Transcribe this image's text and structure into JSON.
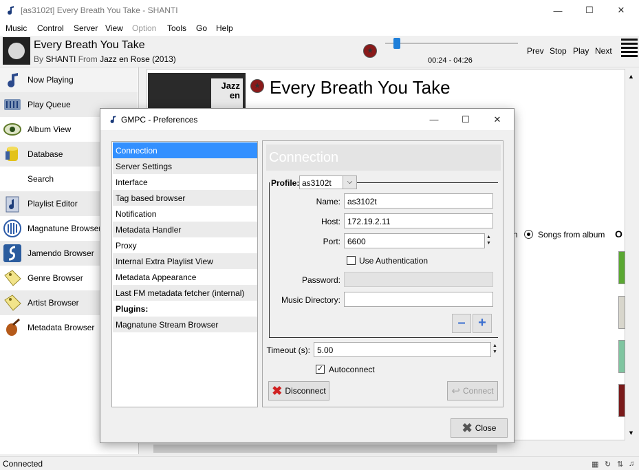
{
  "window": {
    "title": "[as3102t] Every Breath You Take - SHANTI"
  },
  "menubar": {
    "items": [
      "Music",
      "Control",
      "Server",
      "View",
      "Option",
      "Tools",
      "Go",
      "Help"
    ]
  },
  "now_playing": {
    "title": "Every Breath You Take",
    "by_label": "By",
    "artist": "SHANTI",
    "from_label": "From",
    "album": "Jazz en Rose (2013)",
    "time": "00:24 - 04:26",
    "progress": 0.09
  },
  "controls": {
    "prev": "Prev",
    "stop": "Stop",
    "play": "Play",
    "next": "Next"
  },
  "sidebar": {
    "items": [
      {
        "label": "Now Playing",
        "icon": "music-note-icon"
      },
      {
        "label": "Play Queue",
        "icon": "queue-icon"
      },
      {
        "label": "Album View",
        "icon": "eye-icon"
      },
      {
        "label": "Database",
        "icon": "database-icon"
      },
      {
        "label": "Search",
        "icon": "search-icon"
      },
      {
        "label": "Playlist Editor",
        "icon": "playlist-icon"
      },
      {
        "label": "Magnatune Browser",
        "icon": "magnatune-icon"
      },
      {
        "label": "Jamendo Browser",
        "icon": "jamendo-icon"
      },
      {
        "label": "Genre Browser",
        "icon": "tag-icon"
      },
      {
        "label": "Artist Browser",
        "icon": "tag-icon"
      },
      {
        "label": "Metadata Browser",
        "icon": "violin-icon"
      }
    ]
  },
  "main": {
    "title": "Every Breath You Take",
    "cover_text": "Jazz en",
    "trunc_left": "n",
    "songs_from_album": "Songs from album",
    "trunc_right": "O"
  },
  "status": {
    "text": "Connected"
  },
  "dialog": {
    "title": "GMPC - Preferences",
    "pref_items": [
      "Connection",
      "Server Settings",
      "Interface",
      "Tag based browser",
      "Notification",
      "Metadata Handler",
      "Proxy",
      "Internal Extra Playlist View",
      "Metadata Appearance",
      "Last FM metadata fetcher (internal)",
      "Plugins:",
      "Magnatune Stream Browser"
    ],
    "panel_header": "Connection",
    "profile_label": "Profile:",
    "profile_value": "as3102t",
    "name_label": "Name:",
    "name_value": "as3102t",
    "host_label": "Host:",
    "host_value": "172.19.2.11",
    "port_label": "Port:",
    "port_value": "6600",
    "use_auth_label": "Use Authentication",
    "use_auth_checked": false,
    "password_label": "Password:",
    "password_value": "",
    "music_dir_label": "Music Directory:",
    "music_dir_value": "",
    "timeout_label": "Timeout (s):",
    "timeout_value": "5.00",
    "autoconnect_label": "Autoconnect",
    "autoconnect_checked": true,
    "disconnect_label": "Disconnect",
    "connect_label": "Connect",
    "close_label": "Close"
  },
  "colors": {
    "selection": "#3390ff",
    "accent_blue": "#1f7fd9",
    "disconnect_red": "#d02020"
  }
}
